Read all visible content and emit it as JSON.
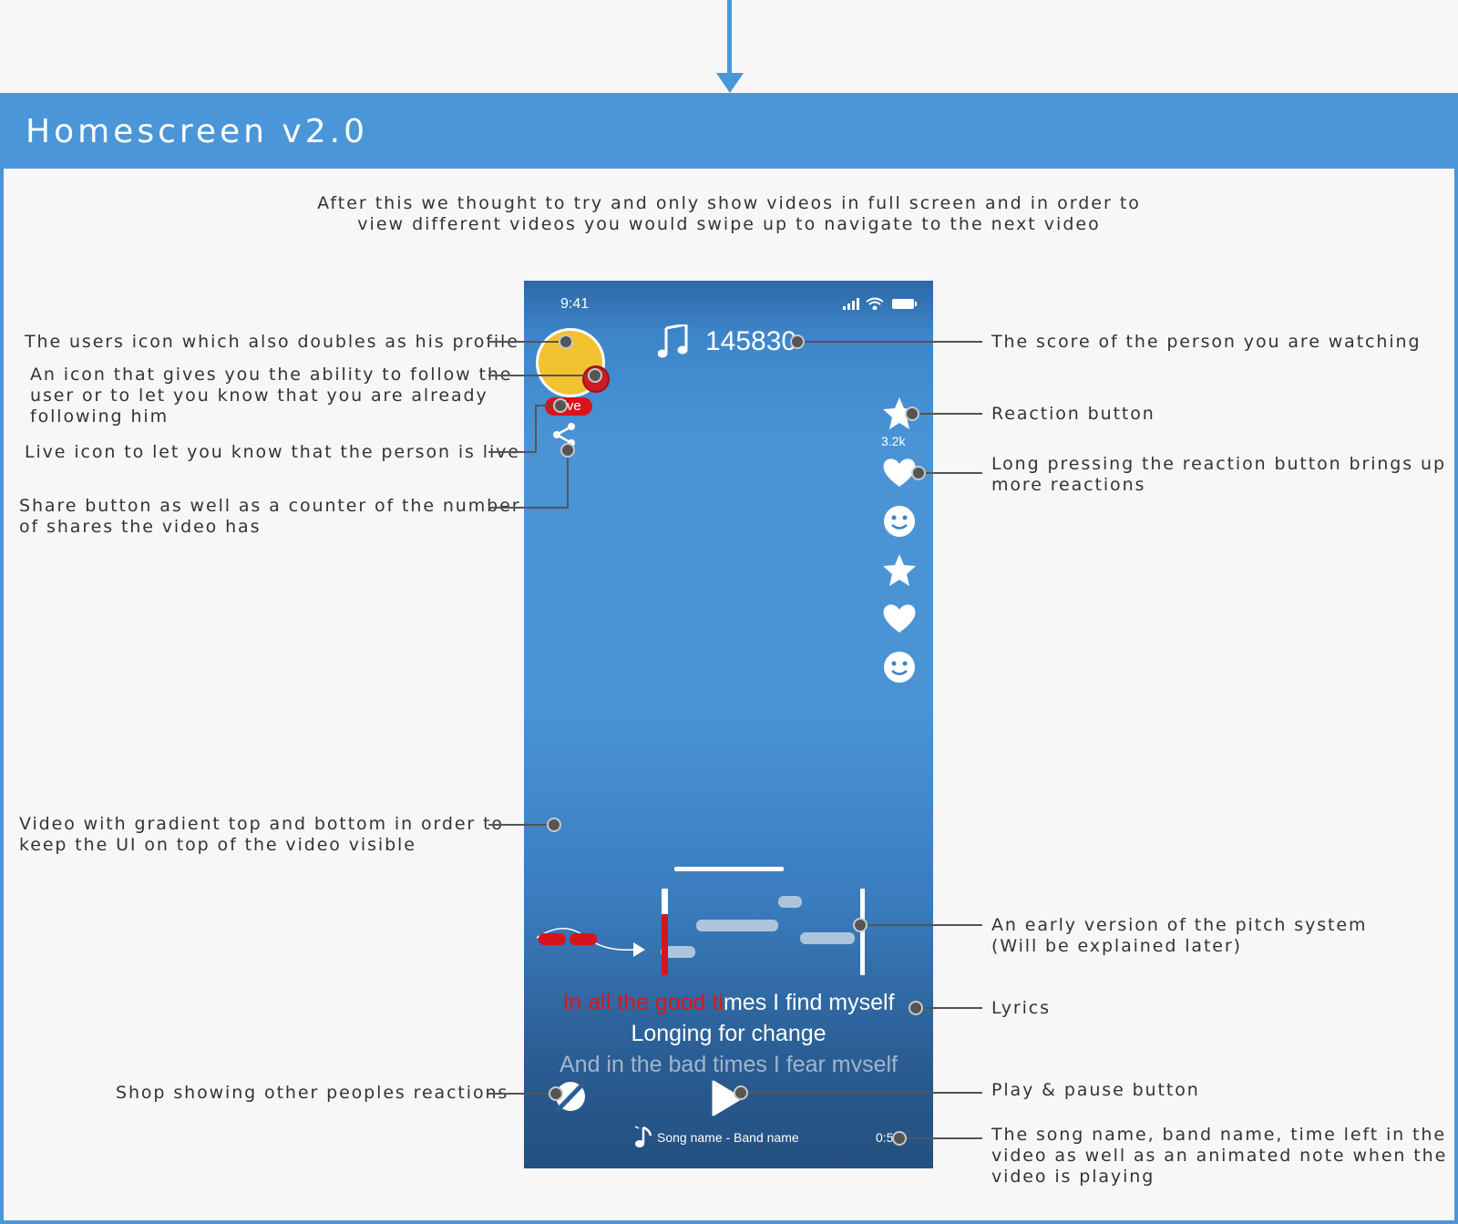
{
  "page": {
    "title": "Homescreen v2.0",
    "intro_line1": "After this we thought to try and only show videos in full screen and in order to",
    "intro_line2": "view different videos you would swipe up to navigate to the next video"
  },
  "annotations_left": {
    "profile": "The users icon which also doubles as his profile",
    "follow_1": "An icon that gives you the ability to follow the",
    "follow_2": "user or to let you know that you are already",
    "follow_3": "following him",
    "live": "Live icon to let you know that the person is live",
    "share_1": "Share button as well as a counter of the number",
    "share_2": "of shares the video has",
    "video_1": "Video with gradient top and bottom in order to",
    "video_2": "keep the UI on top of the video visible",
    "shop": "Shop showing other peoples reactions"
  },
  "annotations_right": {
    "score": "The score of the person you are watching",
    "reaction": "Reaction button",
    "long_press_1": "Long pressing the reaction button brings up",
    "long_press_2": "more reactions",
    "pitch_1": "An early version of the pitch system",
    "pitch_2": "(Will be explained later)",
    "lyrics": "Lyrics",
    "play_pause": "Play & pause button",
    "song_1": "The song name, band name, time left in the",
    "song_2": "video as well as an animated note when the",
    "song_3": "video is playing"
  },
  "phone": {
    "status_time": "9:41",
    "score": "145830",
    "live_label": "Live",
    "reaction_count": "3.2k",
    "lyrics": {
      "line1_sung": "In all the good ti",
      "line1_rest": "mes I find myself",
      "line2": "Longing for change",
      "line3": "And in the bad times I fear myself"
    },
    "song_label": "Song name - Band name",
    "time_left": "0:54",
    "icons": [
      "music-note",
      "share",
      "star",
      "heart",
      "smiley",
      "shop",
      "play",
      "signal",
      "wifi",
      "battery"
    ]
  },
  "colors": {
    "accent": "#4a96d8",
    "live_red": "#d7141c",
    "avatar_yellow": "#f2c230",
    "connector": "#555555"
  }
}
